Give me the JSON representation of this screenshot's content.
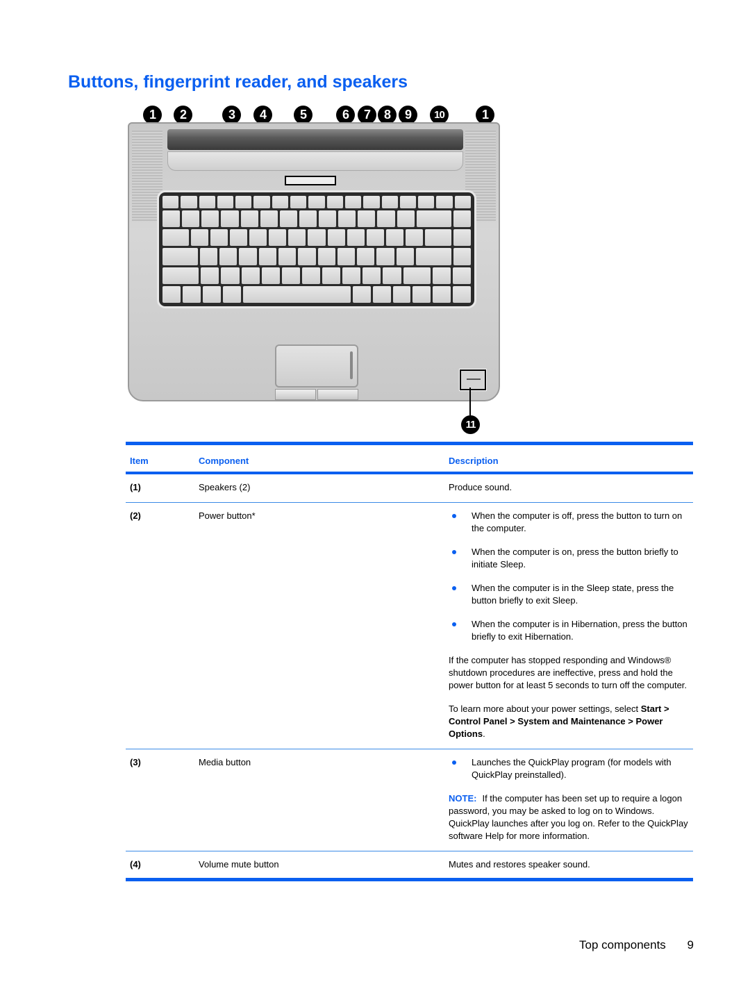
{
  "page": {
    "title": "Buttons, fingerprint reader, and speakers",
    "accent_color": "#0a5ff0"
  },
  "figure": {
    "callouts_top": [
      "1",
      "2",
      "3",
      "4",
      "5",
      "6",
      "7",
      "8",
      "9",
      "10",
      "1"
    ],
    "callout_bottom": "11",
    "description": "Top view of laptop showing speakers, buttons, keyboard, touchpad and fingerprint reader"
  },
  "table": {
    "headers": {
      "item": "Item",
      "component": "Component",
      "description": "Description"
    },
    "rows": [
      {
        "item": "(1)",
        "component": "Speakers (2)",
        "description": "Produce sound."
      },
      {
        "item": "(2)",
        "component": "Power button*",
        "bullets": [
          "When the computer is off, press the button to turn on the computer.",
          "When the computer is on, press the button briefly to initiate Sleep.",
          "When the computer is in the Sleep state, press the button briefly to exit Sleep.",
          "When the computer is in Hibernation, press the button briefly to exit Hibernation."
        ],
        "para1": "If the computer has stopped responding and Windows® shutdown procedures are ineffective, press and hold the power button for at least 5 seconds to turn off the computer.",
        "para2_prefix": "To learn more about your power settings, select ",
        "para2_bold": "Start > Control Panel > System and Maintenance > Power Options",
        "para2_suffix": "."
      },
      {
        "item": "(3)",
        "component": "Media button",
        "bullets": [
          "Launches the QuickPlay program (for models with QuickPlay preinstalled)."
        ],
        "note_label": "NOTE:",
        "note_text": "If the computer has been set up to require a logon password, you may be asked to log on to Windows. QuickPlay launches after you log on. Refer to the QuickPlay software Help for more information."
      },
      {
        "item": "(4)",
        "component": "Volume mute button",
        "description": "Mutes and restores speaker sound."
      }
    ]
  },
  "footer": {
    "section": "Top components",
    "page_number": "9"
  }
}
